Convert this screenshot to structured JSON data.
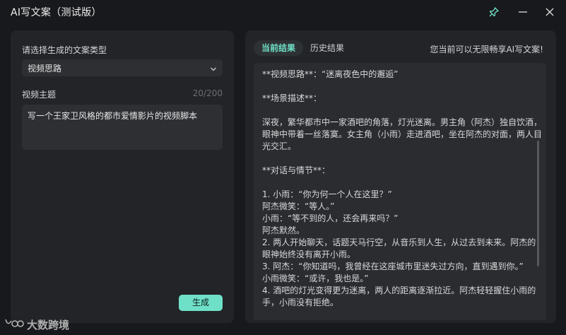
{
  "window": {
    "title": "AI写文案（测试版）",
    "pin_icon": "pin-icon",
    "minimize_icon": "minimize-icon",
    "close_icon": "close-icon",
    "accent_color": "#6fe0c8"
  },
  "left": {
    "type_label": "请选择生成的文案类型",
    "type_value": "视频思路",
    "topic_label": "视频主题",
    "topic_counter": "20/200",
    "topic_text": "写一个王家卫风格的都市爱情影片的视频脚本",
    "generate_label": "生成"
  },
  "right": {
    "tab_current": "当前结果",
    "tab_history": "历史结果",
    "notice": "您当前可以无限畅享AI写文案!",
    "lines": [
      "**视频思路**：“迷离夜色中的邂逅”",
      "",
      "**场景描述**：",
      "",
      "深夜，繁华都市中一家酒吧的角落，灯光迷离。男主角（阿杰）独自饮酒，眼神中带着一丝落寞。女主角（小雨）走进酒吧，坐在阿杰的对面，两人目光交汇。",
      "",
      "**对话与情节**：",
      "",
      "1. 小雨：“你为何一个人在这里？”",
      "阿杰微笑：“等人。”",
      "小雨：“等不到的人，还会再来吗？”",
      "阿杰默然。",
      "2. 两人开始聊天，话题天马行空，从音乐到人生，从过去到未来。阿杰的眼神始终没有离开小雨。",
      "3. 阿杰：“你知道吗，我曾经在这座城市里迷失过方向，直到遇到你。”",
      "小雨微笑：“或许，我也是。”",
      "4. 酒吧的灯光变得更为迷离，两人的距离逐渐拉近。阿杰轻轻握住小雨的手，小雨没有拒绝。"
    ]
  },
  "watermark": {
    "text": "大数跨境"
  }
}
